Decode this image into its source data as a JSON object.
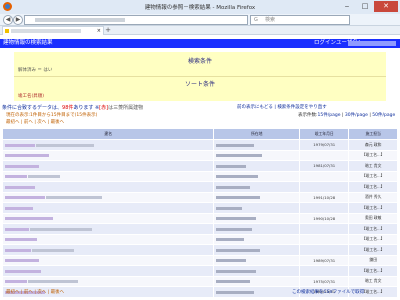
{
  "window": {
    "title": "建物情報の参照－検索結果 - Mozilla Firefox",
    "minimize": "‒",
    "maximize": "□",
    "close": "✕"
  },
  "browser": {
    "back": "◀",
    "forward": "▶",
    "search_placeholder": "検索",
    "new_tab": "+"
  },
  "header": {
    "title": "建物情報の検索結果",
    "login_label": "ログインユーザ名："
  },
  "conditions": {
    "title": "検索条件",
    "item": "解体済み ＝ はい",
    "sort_title": "ソート条件",
    "sort_item": "竣工名(昇順)"
  },
  "summary": {
    "prefix": "条件に合致するデータは、",
    "count": "98件",
    "suffix": "あります ※",
    "mark": "[赤]",
    "note": "は三菱所属建物"
  },
  "links": {
    "back_to_search": "前の表示にもどる",
    "change_conditions": "検索条件設定をやり直す",
    "csv_download": "この検索結果をCSVファイルで取得"
  },
  "display": {
    "range": "現在の表示:1件目から15件目まで(15件表示)",
    "per_page_label": "表示件数:",
    "per_page_15": "15件/page",
    "per_page_30": "30件/page",
    "per_page_50": "50件/page"
  },
  "pager": [
    "最初へ",
    "前へ",
    "次へ",
    "最後へ"
  ],
  "table": {
    "headers": [
      "建名",
      "所在地",
      "竣工年月日",
      "施工担当"
    ],
    "rows": [
      {
        "date": "1979/07/31",
        "staff": "森元 政和"
      },
      {
        "date": "",
        "staff": "【竣工名…】"
      },
      {
        "date": "1981/07/31",
        "staff": "暗工 貴文"
      },
      {
        "date": "",
        "staff": "【竣工名…】"
      },
      {
        "date": "",
        "staff": "【竣工名…】"
      },
      {
        "date": "1991/10/28",
        "staff": "酒井 秀久"
      },
      {
        "date": "",
        "staff": "【竣工名…】"
      },
      {
        "date": "1990/10/28",
        "staff": "奥田 政敏"
      },
      {
        "date": "",
        "staff": "【竣工名…】"
      },
      {
        "date": "",
        "staff": "【竣工名…】"
      },
      {
        "date": "",
        "staff": "【竣工名…】"
      },
      {
        "date": "1989/07/31",
        "staff": "鎌田"
      },
      {
        "date": "",
        "staff": "【竣工名…】"
      },
      {
        "date": "1975/07/31",
        "staff": "暗工 貴文"
      },
      {
        "date": "1980/10/31",
        "staff": "【竣工名…】"
      }
    ]
  },
  "colors": {
    "header_blue": "#1a2fff",
    "condition_bg": "#ffffc2",
    "table_header": "#b8c6e8",
    "highlight_red": "#dd0000"
  }
}
